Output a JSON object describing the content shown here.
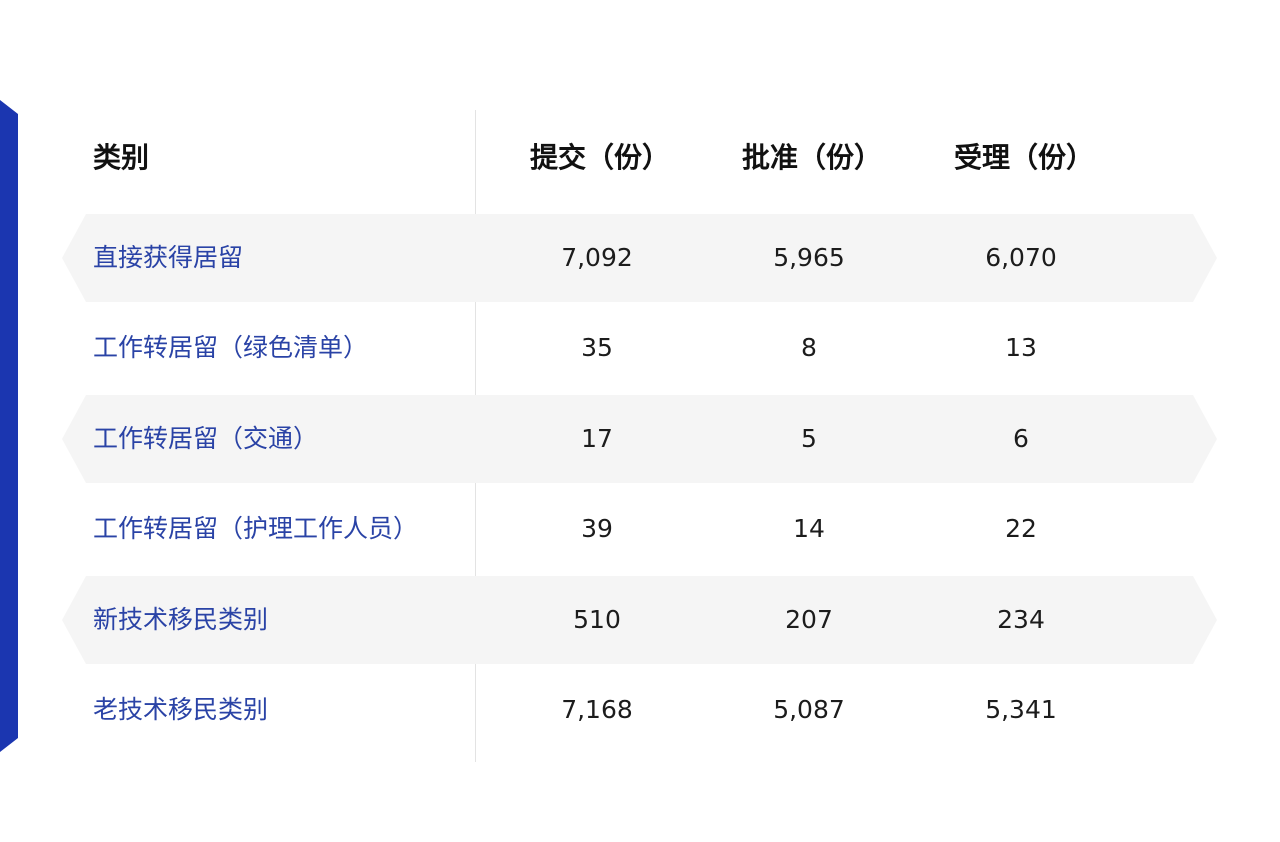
{
  "table": {
    "headers": [
      "类别",
      "提交（份）",
      "批准（份）",
      "受理（份）"
    ],
    "rows": [
      {
        "category": "直接获得居留",
        "submitted": "7,092",
        "approved": "5,965",
        "accepted": "6,070"
      },
      {
        "category": "工作转居留（绿色清单）",
        "submitted": "35",
        "approved": "8",
        "accepted": "13"
      },
      {
        "category": "工作转居留（交通）",
        "submitted": "17",
        "approved": "5",
        "accepted": "6"
      },
      {
        "category": "工作转居留（护理工作人员）",
        "submitted": "39",
        "approved": "14",
        "accepted": "22"
      },
      {
        "category": "新技术移民类别",
        "submitted": "510",
        "approved": "207",
        "accepted": "234"
      },
      {
        "category": "老技术移民类别",
        "submitted": "7,168",
        "approved": "5,087",
        "accepted": "5,341"
      }
    ]
  },
  "colors": {
    "accent": "#1b36b0",
    "category_text": "#2a43a6",
    "row_band": "#f5f5f5"
  }
}
